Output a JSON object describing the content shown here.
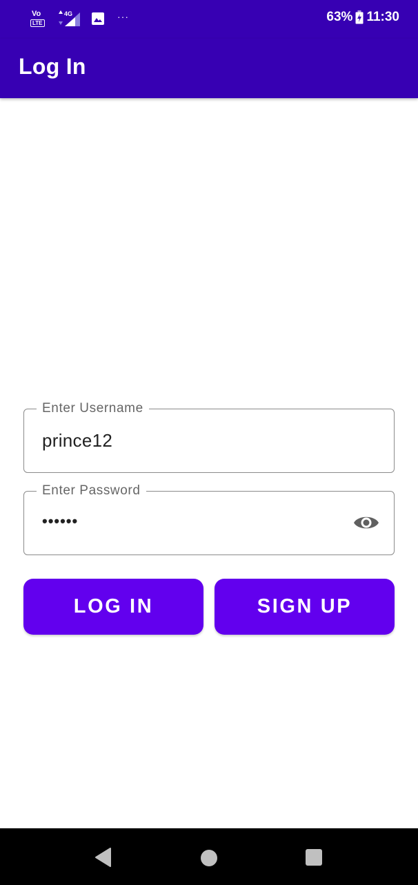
{
  "status_bar": {
    "network_vo": "Vo",
    "network_lte": "LTE",
    "network_type": "4G",
    "more_indicator": "···",
    "battery_percent": "63%",
    "time": "11:30"
  },
  "app_bar": {
    "title": "Log In"
  },
  "form": {
    "username": {
      "label": "Enter Username",
      "value": "prince12"
    },
    "password": {
      "label": "Enter Password",
      "masked_value": "••••••"
    }
  },
  "buttons": {
    "login_label": "LOG IN",
    "signup_label": "SIGN UP"
  },
  "icons": {
    "password_toggle": "eye-icon",
    "back": "back-triangle-icon",
    "home": "home-circle-icon",
    "recents": "recents-square-icon"
  },
  "colors": {
    "primary_dark": "#3700b3",
    "primary": "#6200ee",
    "field_border": "#8a8a8a",
    "label_text": "#666666"
  }
}
